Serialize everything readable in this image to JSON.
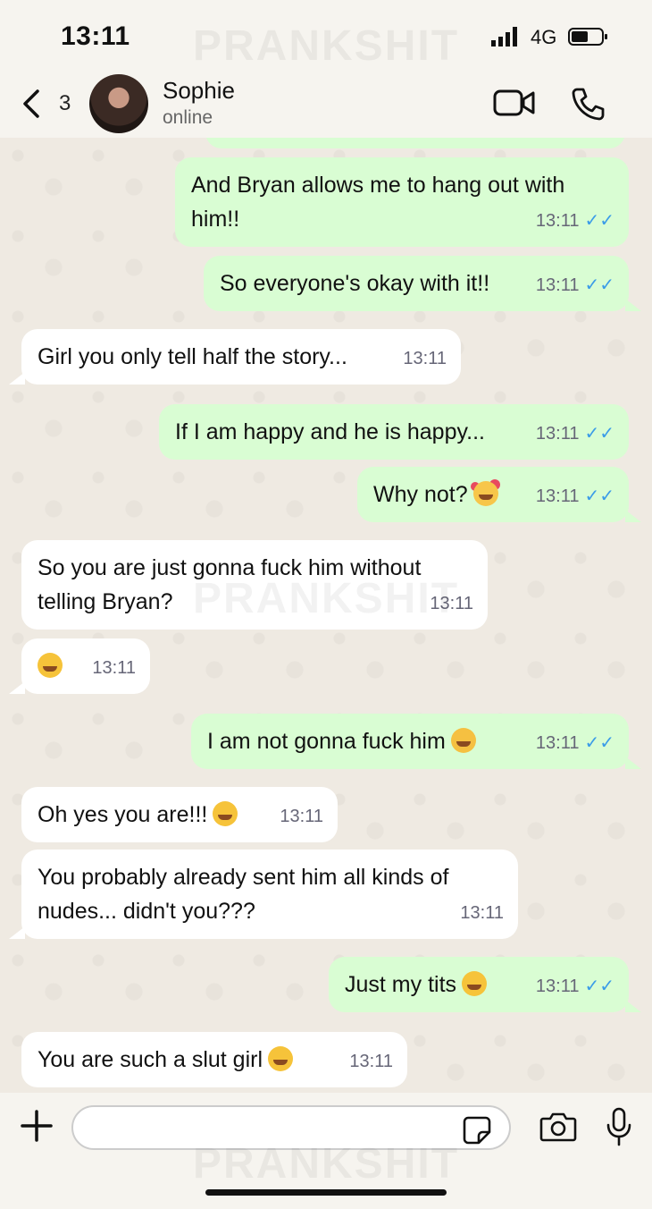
{
  "status_bar": {
    "time": "13:11",
    "network": "4G"
  },
  "watermark": "PRANKSHIT",
  "header": {
    "back_count": "3",
    "contact_name": "Sophie",
    "contact_status": "online"
  },
  "messages": [
    {
      "dir": "out",
      "text": "And Bryan allows me to hang out with him!!",
      "time": "13:11",
      "read": true
    },
    {
      "dir": "out",
      "text": "So everyone's okay with it!!",
      "time": "13:11",
      "read": true
    },
    {
      "dir": "in",
      "text": "Girl you only tell half the story...",
      "time": "13:11"
    },
    {
      "dir": "out",
      "text": "If I am happy and he is happy...",
      "time": "13:11",
      "read": true
    },
    {
      "dir": "out",
      "text": "Why not?",
      "emoji": "smiling-face-with-hearts",
      "time": "13:11",
      "read": true
    },
    {
      "dir": "in",
      "text": "So you are just gonna fuck him without telling Bryan?",
      "time": "13:11"
    },
    {
      "dir": "in",
      "text": "",
      "emoji": "grinning-sweat",
      "time": "13:11"
    },
    {
      "dir": "out",
      "text": "I am not gonna fuck him",
      "emoji": "relieved-face",
      "time": "13:11",
      "read": true
    },
    {
      "dir": "in",
      "text": "Oh yes you are!!!",
      "emoji": "tears-of-joy",
      "time": "13:11"
    },
    {
      "dir": "in",
      "text": "You probably already sent him all kinds of nudes... didn't you???",
      "time": "13:11"
    },
    {
      "dir": "out",
      "text": "Just my tits",
      "emoji": "flushed-face",
      "time": "13:11",
      "read": true
    },
    {
      "dir": "in",
      "text": "You are such a slut girl",
      "emoji": "squinting-tongue",
      "time": "13:11"
    }
  ],
  "icons": {
    "back": "chevron-left-icon",
    "video": "video-camera-icon",
    "call": "phone-icon",
    "attach": "plus-icon",
    "sticker": "sticker-icon",
    "camera": "camera-icon",
    "mic": "microphone-icon"
  },
  "colors": {
    "outgoing_bubble": "#d9fdd3",
    "incoming_bubble": "#ffffff",
    "read_tick": "#3a9be8"
  }
}
